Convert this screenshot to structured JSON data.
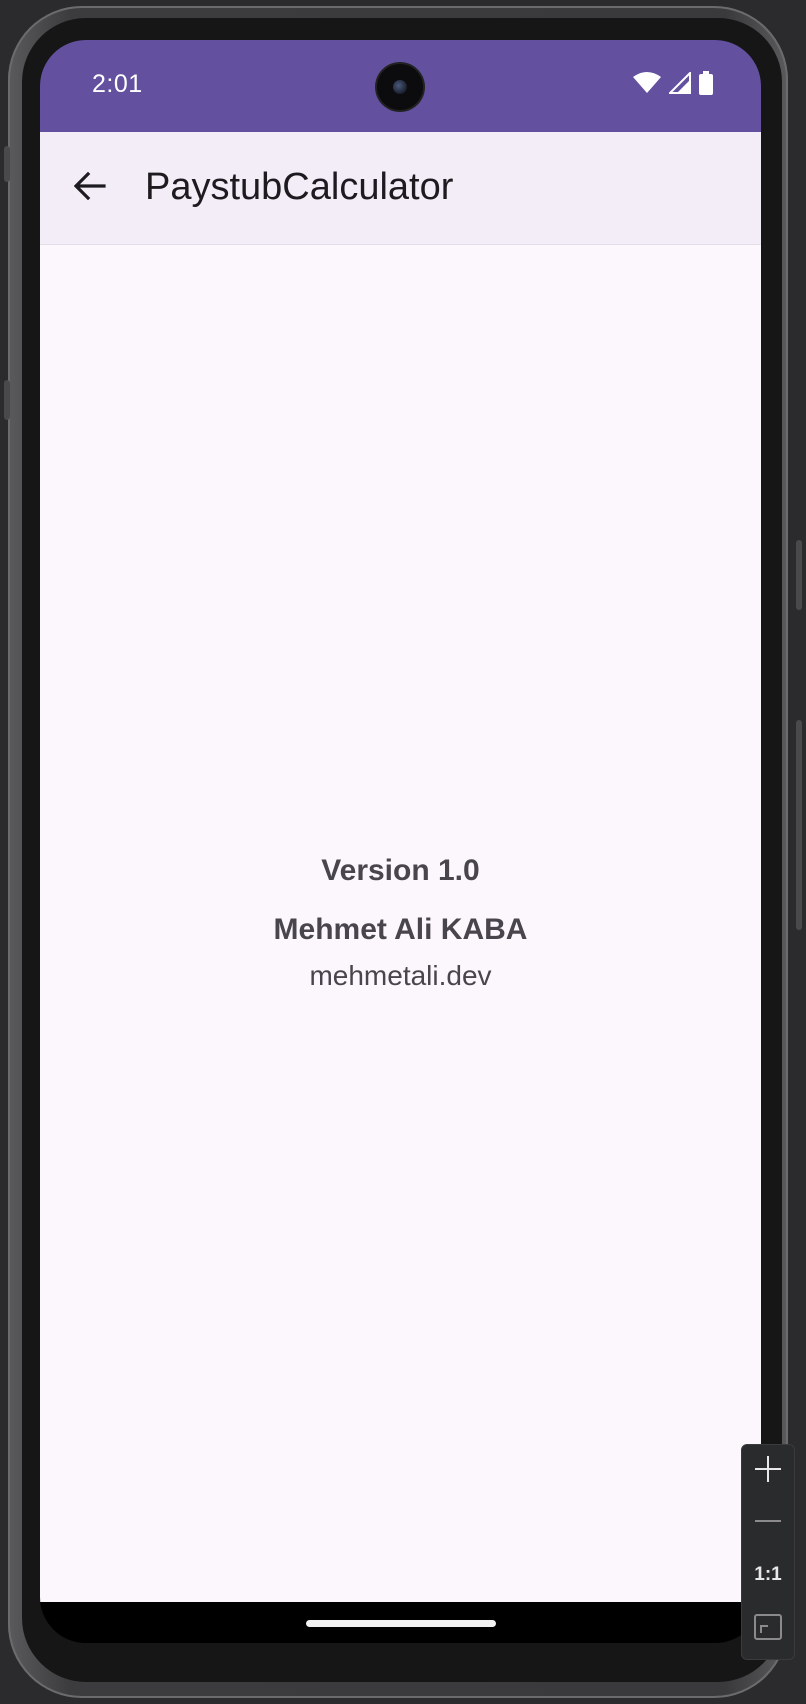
{
  "status_bar": {
    "time": "2:01",
    "icons": [
      "wifi-icon",
      "cellular-signal-icon",
      "battery-icon"
    ],
    "color": "#6351a0"
  },
  "app_bar": {
    "back_icon": "arrow-left-icon",
    "title": "PaystubCalculator",
    "background": "#f2edf6"
  },
  "about": {
    "version": "Version 1.0",
    "author": "Mehmet Ali KABA",
    "website": "mehmetali.dev"
  },
  "emulator_zoom": {
    "zoom_in_icon": "plus-icon",
    "zoom_out_icon": "minus-icon",
    "actual_size_label": "1:1",
    "fit_icon": "fit-screen-icon"
  }
}
